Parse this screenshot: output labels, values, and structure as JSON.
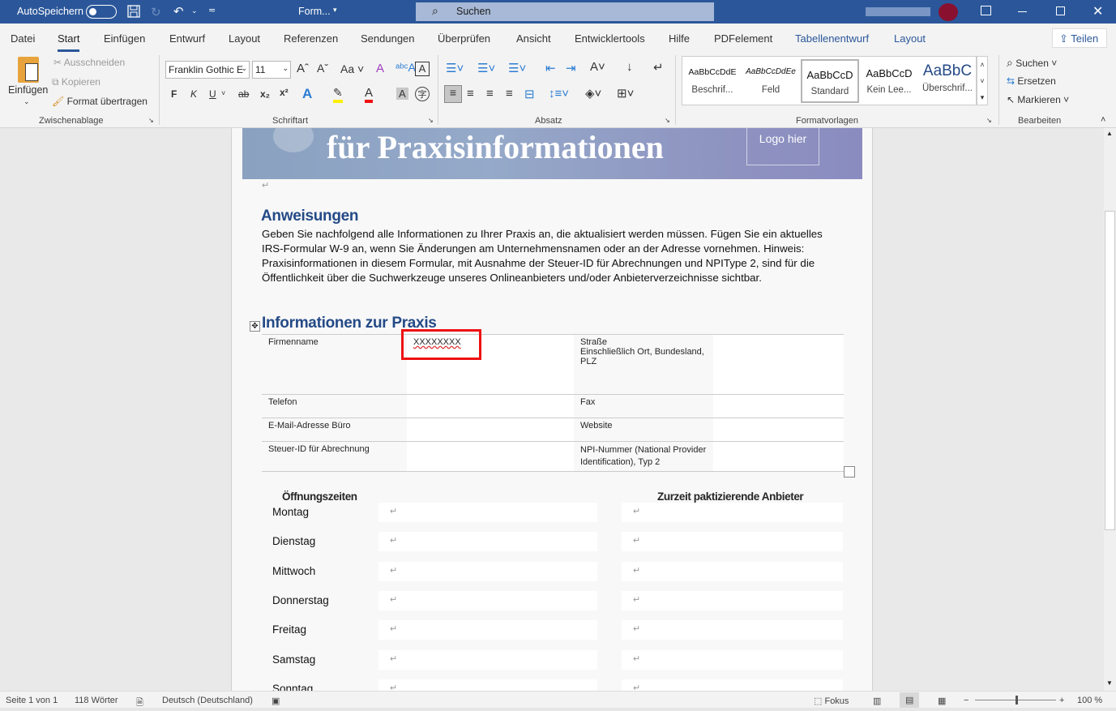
{
  "titlebar": {
    "autosave": "AutoSpeichern",
    "autosave_on": false,
    "doc_title": "Form...",
    "search": "Suchen"
  },
  "tabs": [
    "Datei",
    "Start",
    "Einfügen",
    "Entwurf",
    "Layout",
    "Referenzen",
    "Sendungen",
    "Überprüfen",
    "Ansicht",
    "Entwicklertools",
    "Hilfe",
    "PDFelement",
    "Tabellenentwurf",
    "Layout"
  ],
  "active_tab": "Start",
  "share": "Teilen",
  "clipboard": {
    "paste": "Einfügen",
    "cut": "Ausschneiden",
    "copy": "Kopieren",
    "format_painter": "Format übertragen",
    "group": "Zwischenablage"
  },
  "font": {
    "name": "Franklin Gothic E",
    "size": "11",
    "group": "Schriftart",
    "bold": "F",
    "italic": "K",
    "underline": "U",
    "case": "Aa"
  },
  "paragraph": {
    "group": "Absatz"
  },
  "styles": {
    "group": "Formatvorlagen",
    "items": [
      {
        "preview": "AaBbCcDdE",
        "name": "Beschrif..."
      },
      {
        "preview": "AaBbCcDdEe",
        "name": "Feld"
      },
      {
        "preview": "AaBbCcD",
        "name": "Standard"
      },
      {
        "preview": "AaBbCcD",
        "name": "Kein Lee..."
      },
      {
        "preview": "AaBbC",
        "name": "Überschrif..."
      }
    ]
  },
  "editing": {
    "group": "Bearbeiten",
    "find": "Suchen",
    "replace": "Ersetzen",
    "select": "Markieren"
  },
  "document": {
    "banner_title": "für Praxisinformationen",
    "logo": "Logo hier",
    "h_instructions": "Anweisungen",
    "instructions": "Geben Sie nachfolgend alle Informationen zu Ihrer Praxis an, die aktualisiert werden müssen. Fügen Sie ein aktuelles IRS-Formular W-9 an, wenn Sie Änderungen am Unternehmensnamen oder an der Adresse vornehmen. Hinweis: Praxisinformationen in diesem Formular, mit Ausnahme der Steuer-ID für Abrechnungen und NPIType 2, sind für die Öffentlichkeit über die Suchwerkzeuge unseres Onlineanbieters und/oder Anbieterverzeichnisse sichtbar.",
    "h_info": "Informationen zur Praxis",
    "table": [
      {
        "l1": "Firmenname",
        "v1": "XXXXXXXX",
        "l2": "Straße",
        "l2b": "Einschließlich Ort, Bundesland, PLZ",
        "v2": ""
      },
      {
        "l1": "Telefon",
        "v1": "",
        "l2": "Fax",
        "v2": ""
      },
      {
        "l1": "E-Mail-Adresse Büro",
        "v1": "",
        "l2": "Website",
        "v2": ""
      },
      {
        "l1": "Steuer-ID für Abrechnung",
        "v1": "",
        "l2": "NPI-Nummer (National Provider Identification), Typ 2",
        "v2": ""
      }
    ],
    "hours_header": "Öffnungszeiten",
    "providers_header": "Zurzeit paktizierende Anbieter",
    "days": [
      "Montag",
      "Dienstag",
      "Mittwoch",
      "Donnerstag",
      "Freitag",
      "Samstag",
      "Sonntag"
    ]
  },
  "status": {
    "page": "Seite 1 von 1",
    "words": "118 Wörter",
    "language": "Deutsch (Deutschland)",
    "focus": "Fokus",
    "zoom": "100 %",
    "zoom_percent": 100
  },
  "colors": {
    "titlebar": "#2b579a",
    "heading": "#244a86",
    "highlight_box": "#ee1111"
  }
}
